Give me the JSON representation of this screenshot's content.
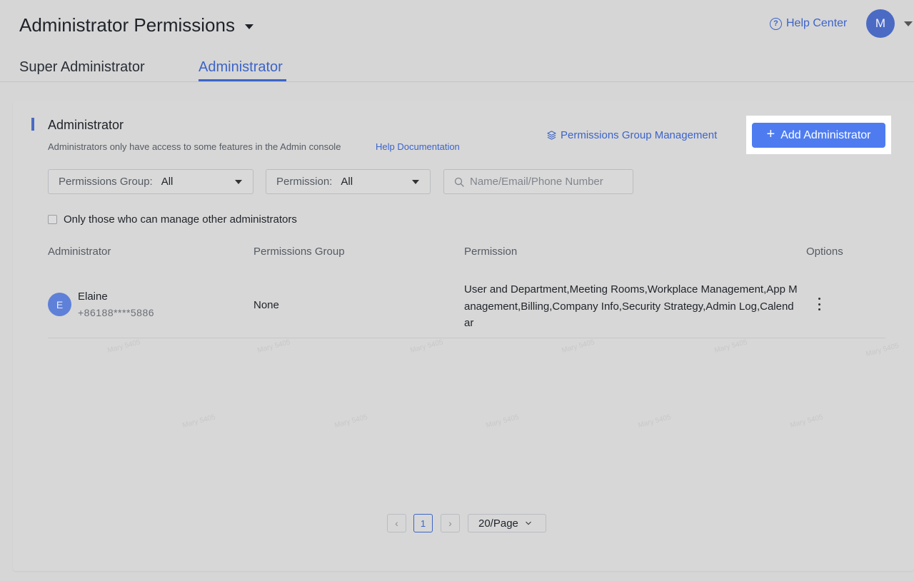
{
  "header": {
    "title": "Administrator Permissions",
    "help_center": "Help Center",
    "help_glyph": "?",
    "avatar_initial": "M"
  },
  "tabs": [
    {
      "label": "Super Administrator",
      "active": false
    },
    {
      "label": "Administrator",
      "active": true
    }
  ],
  "section": {
    "title": "Administrator",
    "description": "Administrators only have access to some features in the Admin console",
    "help_doc": "Help Documentation",
    "group_management": "Permissions Group Management",
    "add_button": "Add Administrator",
    "add_plus": "+"
  },
  "filters": {
    "group_label": "Permissions Group:",
    "group_value": "All",
    "permission_label": "Permission:",
    "permission_value": "All",
    "search_placeholder": "Name/Email/Phone Number",
    "only_manage_label": "Only those who can manage other administrators"
  },
  "table": {
    "columns": [
      "Administrator",
      "Permissions Group",
      "Permission",
      "Options"
    ],
    "rows": [
      {
        "initial": "E",
        "name": "Elaine",
        "phone": "+86188****5886",
        "group": "None",
        "permission": "User and Department,Meeting Rooms,Workplace Management,App Management,Billing,Company Info,Security Strategy,Admin Log,Calendar"
      }
    ]
  },
  "pagination": {
    "prev": "‹",
    "current": "1",
    "next": "›",
    "page_size": "20/Page"
  },
  "watermark": "Mary 5405",
  "colors": {
    "accent": "#3c64c8",
    "primary_button": "#4e7cf0",
    "background": "#d6d6d6"
  }
}
